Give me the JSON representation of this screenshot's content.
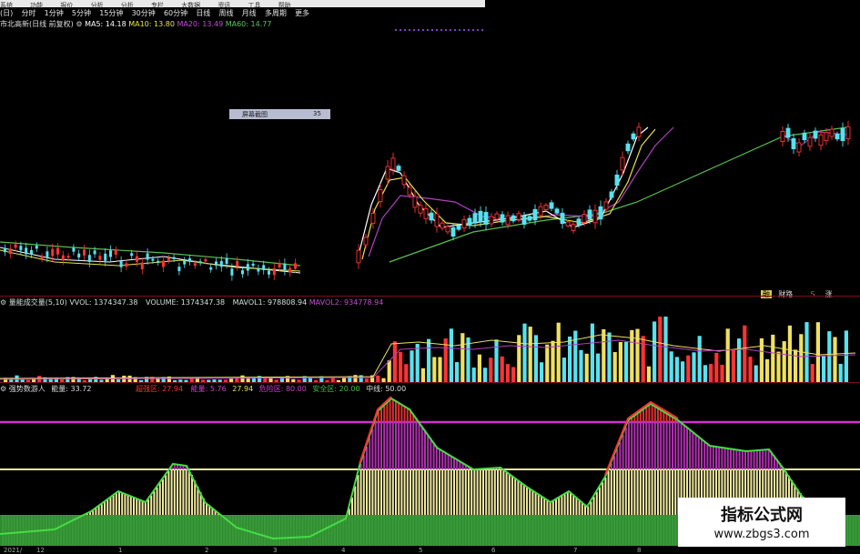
{
  "menu": {
    "items": [
      "系统",
      "功能",
      "报价",
      "分析",
      "分析",
      "专栏",
      "大数据",
      "资讯",
      "工具",
      "帮助"
    ]
  },
  "timeframes": [
    "(日)",
    "分时",
    "1分钟",
    "5分钟",
    "15分钟",
    "30分钟",
    "60分钟",
    "日线",
    "周线",
    "月线",
    "多周期",
    "更多"
  ],
  "ma_line": {
    "stock_name": "市北高新(日线 前复权)",
    "ma5": "MA5: 14.18",
    "ma10": "MA10: 13.80",
    "ma20": "MA20: 13.49",
    "ma60": "MA60: 14.77"
  },
  "tooltip": {
    "label": "屏幕截图",
    "value": "35"
  },
  "main_badges": {
    "b1": "融",
    "b2": "财路",
    "b3": "S",
    "b4": "涨"
  },
  "volume_header": {
    "name": "量能成交量(5,10)",
    "vvol": "VVOL: 1374347.38",
    "volume": "VOLUME: 1374347.38",
    "mavol1": "MAVOL1: 978808.94",
    "mavol2": "MAVOL2: 934778.94"
  },
  "indicator_header": {
    "name": "强势数游人",
    "level": "能量: 33.72",
    "l1": "超强区: 27.94",
    "l2": "能量: 5.76",
    "l3": "27.94",
    "l4": "危险区: 80.00",
    "l5": "安全区: 20.00",
    "l6": "中线: 50.00"
  },
  "watermark": {
    "line1": "指标公式网",
    "line2": "www.zbgs3.com"
  },
  "date_labels": [
    "2021/",
    "12",
    "1",
    "2",
    "3",
    "4",
    "5",
    "6",
    "7",
    "8"
  ],
  "colors": {
    "background": "#000000",
    "up": "#ff3333",
    "down": "#55e3f0",
    "ma5": "#ffffff",
    "ma10": "#e8e34a",
    "ma20": "#b040c0",
    "ma60": "#58c050",
    "danger_line": "#d030d0",
    "mid_line": "#f0f0a0",
    "safe_fill": "#2d8a2d"
  }
}
